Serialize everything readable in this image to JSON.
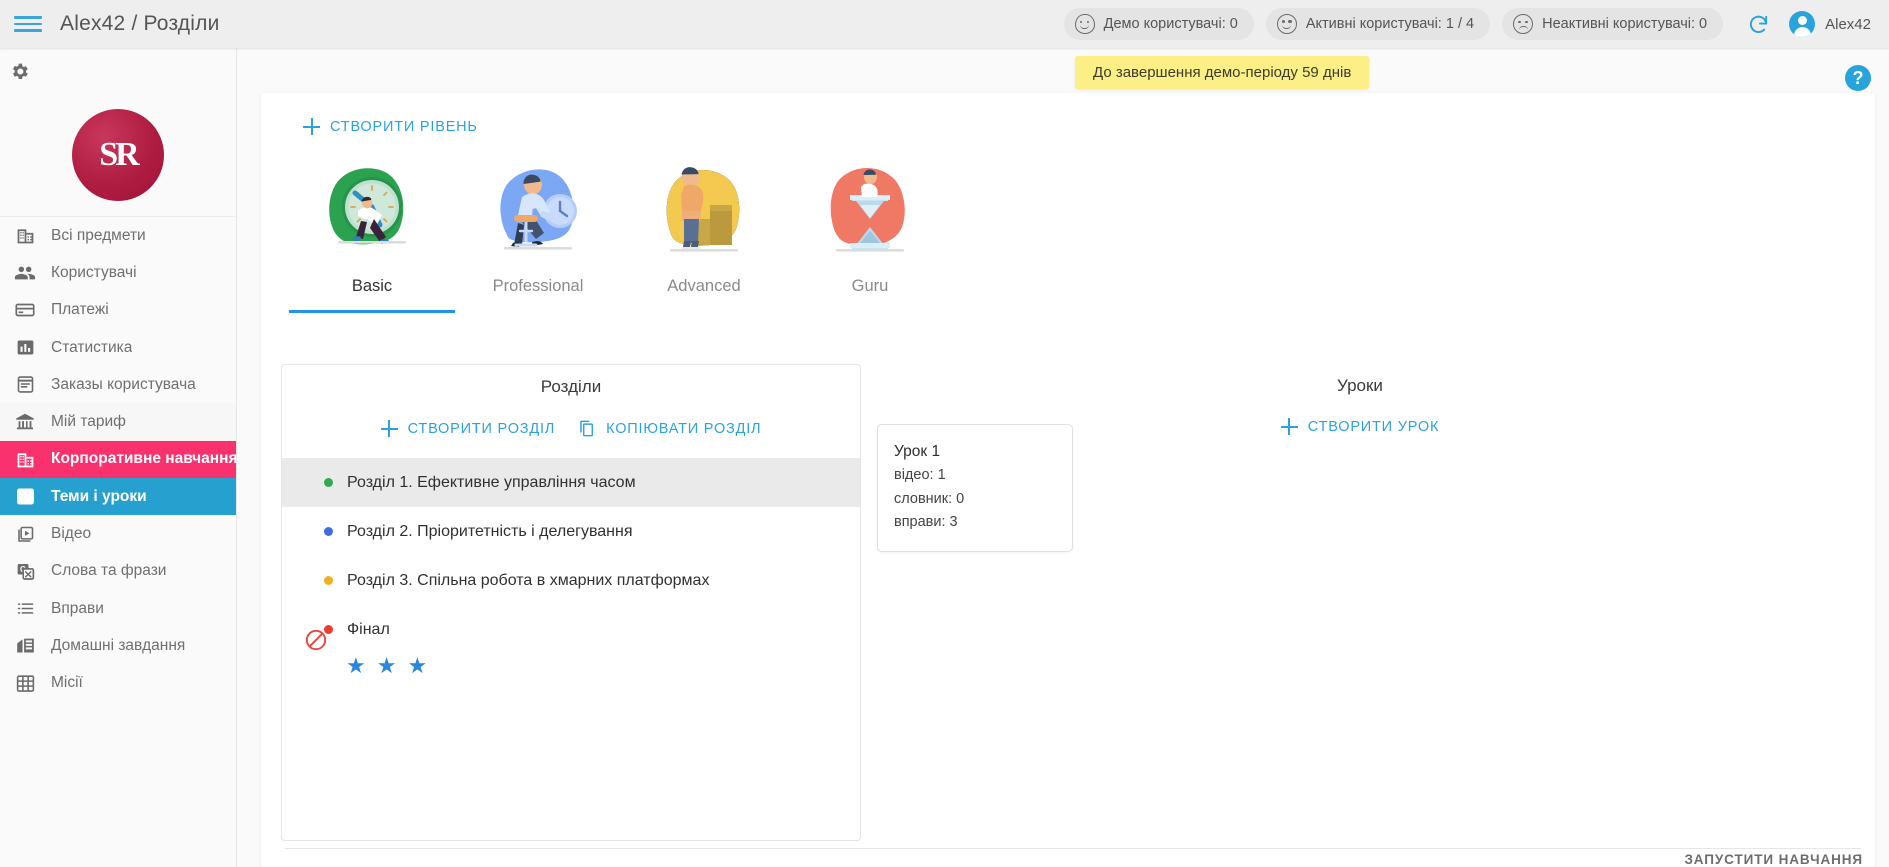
{
  "header": {
    "menu_icon": "hamburger-icon",
    "breadcrumb": "Alex42 / Розділи",
    "stats": [
      {
        "icon": "demo-face-icon",
        "label": "Демо користувачі: 0"
      },
      {
        "icon": "active-face-icon",
        "label": "Активні користувачі: 1 / 4"
      },
      {
        "icon": "inactive-face-icon",
        "label": "Неактивні користувачі: 0"
      }
    ],
    "refresh_icon": "refresh-icon",
    "account_icon": "account-avatar-icon",
    "user_name": "Alex42"
  },
  "sidebar": {
    "settings_icon": "gear-icon",
    "logo_text": "SR",
    "items": [
      {
        "label": "Всі предмети",
        "icon": "building-icon",
        "state": "normal"
      },
      {
        "label": "Користувачі",
        "icon": "people-icon",
        "state": "normal"
      },
      {
        "label": "Платежі",
        "icon": "credit-card-icon",
        "state": "normal"
      },
      {
        "label": "Статистика",
        "icon": "bar-chart-icon",
        "state": "normal"
      },
      {
        "label": "Заказы користувача",
        "icon": "receipt-icon",
        "state": "normal"
      },
      {
        "label": "Мій тариф",
        "icon": "bank-icon",
        "state": "group"
      },
      {
        "label": "Корпоративне навчання",
        "icon": "company-icon",
        "state": "pink"
      },
      {
        "label": "Теми і уроки",
        "icon": "list-box-icon",
        "state": "blue"
      },
      {
        "label": "Відео",
        "icon": "video-icon",
        "state": "normal"
      },
      {
        "label": "Слова та фрази",
        "icon": "translate-icon",
        "state": "normal"
      },
      {
        "label": "Вправи",
        "icon": "bullet-list-icon",
        "state": "normal"
      },
      {
        "label": "Домашні завдання",
        "icon": "home-work-icon",
        "state": "normal"
      },
      {
        "label": "Місії",
        "icon": "grid-icon",
        "state": "normal"
      }
    ]
  },
  "main": {
    "demo_banner": "До завершення демо-періоду 59 днів",
    "help_icon": "help-icon",
    "help_label": "?",
    "create_level_label": "СТВОРИТИ РІВЕНЬ",
    "levels": [
      {
        "name": "Basic",
        "art": "clock-runner-illustration",
        "active": true
      },
      {
        "name": "Professional",
        "art": "desk-clock-illustration",
        "active": false
      },
      {
        "name": "Advanced",
        "art": "stairs-illustration",
        "active": false
      },
      {
        "name": "Guru",
        "art": "hourglass-illustration",
        "active": false
      }
    ],
    "sections_panel": {
      "title": "Розділи",
      "create_label": "СТВОРИТИ РОЗДІЛ",
      "copy_label": "КОПІЮВАТИ РОЗДІЛ",
      "copy_icon": "copy-icon",
      "rows": [
        {
          "label": "Розділ 1. Ефективне управління часом",
          "dot": "#2fa84f",
          "selected": true
        },
        {
          "label": "Розділ 2. Пріоритетність і делегування",
          "dot": "#3d6ee0",
          "selected": false
        },
        {
          "label": "Розділ 3. Спільна робота в хмарних платформах",
          "dot": "#f2b01e",
          "selected": false
        },
        {
          "label": "Фінал",
          "dot": "#ef3b2d",
          "selected": false
        }
      ],
      "blocked_icon": "blocked-icon",
      "stars": [
        "★",
        "★",
        "★"
      ],
      "star_color": "#2a86de"
    },
    "lessons_panel": {
      "title": "Уроки",
      "create_label": "СТВОРИТИ УРОК",
      "cards": [
        {
          "title": "Урок 1",
          "lines": [
            "відео: 1",
            "словник: 0",
            "вправи: 3"
          ]
        }
      ]
    },
    "start_training_label": "ЗАПУСТИТИ НАВЧАННЯ"
  }
}
